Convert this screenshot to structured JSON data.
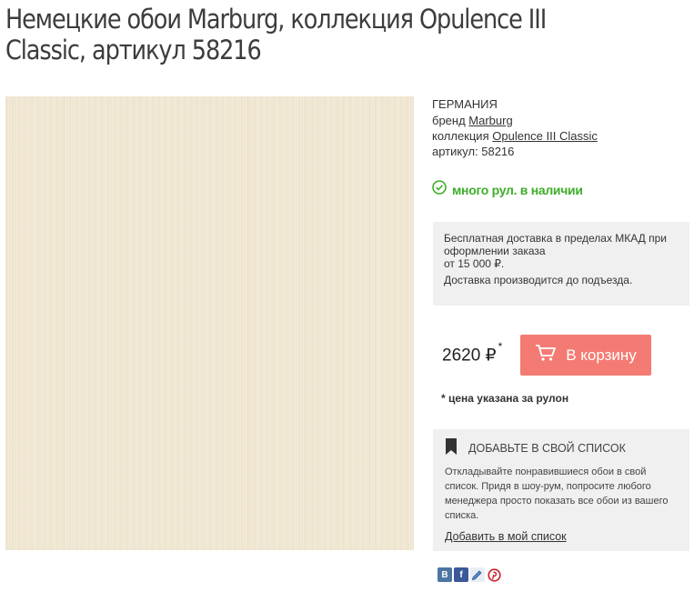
{
  "page": {
    "title_line1": "Немецкие обои Marburg, коллекция Opulence III",
    "title_line2": "Classic, артикул 58216"
  },
  "product": {
    "country": "ГЕРМАНИЯ",
    "brand_label": "бренд",
    "brand": "Marburg",
    "collection_label": "коллекция",
    "collection": "Opulence III Classic",
    "article": "артикул: 58216",
    "swatch_color": "#f0e7d3"
  },
  "stock": {
    "text": "много рул. в наличии",
    "color": "#3fae2a"
  },
  "delivery": {
    "line1": "Бесплатная доставка в пределах МКАД при оформлении заказа",
    "line2": "от 15 000 ₽.",
    "line3": "Доставка производится до подъезда."
  },
  "price": {
    "value": "2620 ₽",
    "mark": "*",
    "note": "* цена указана за рулон"
  },
  "cart": {
    "label": "В корзину",
    "color": "#f47b73"
  },
  "wishlist": {
    "heading": "ДОБАВЬТЕ В СВОЙ СПИСОК",
    "description": "Откладывайте понравившиеся обои в свой список. Придя в шоу-рум, попросите любого менеджера просто показать все обои из вашего списка.",
    "link": "Добавить в мой список"
  },
  "social": {
    "icons": [
      "vk-icon",
      "facebook-icon",
      "livejournal-icon",
      "pinterest-icon"
    ],
    "vk_glyph": "В",
    "fb_glyph": "f"
  }
}
